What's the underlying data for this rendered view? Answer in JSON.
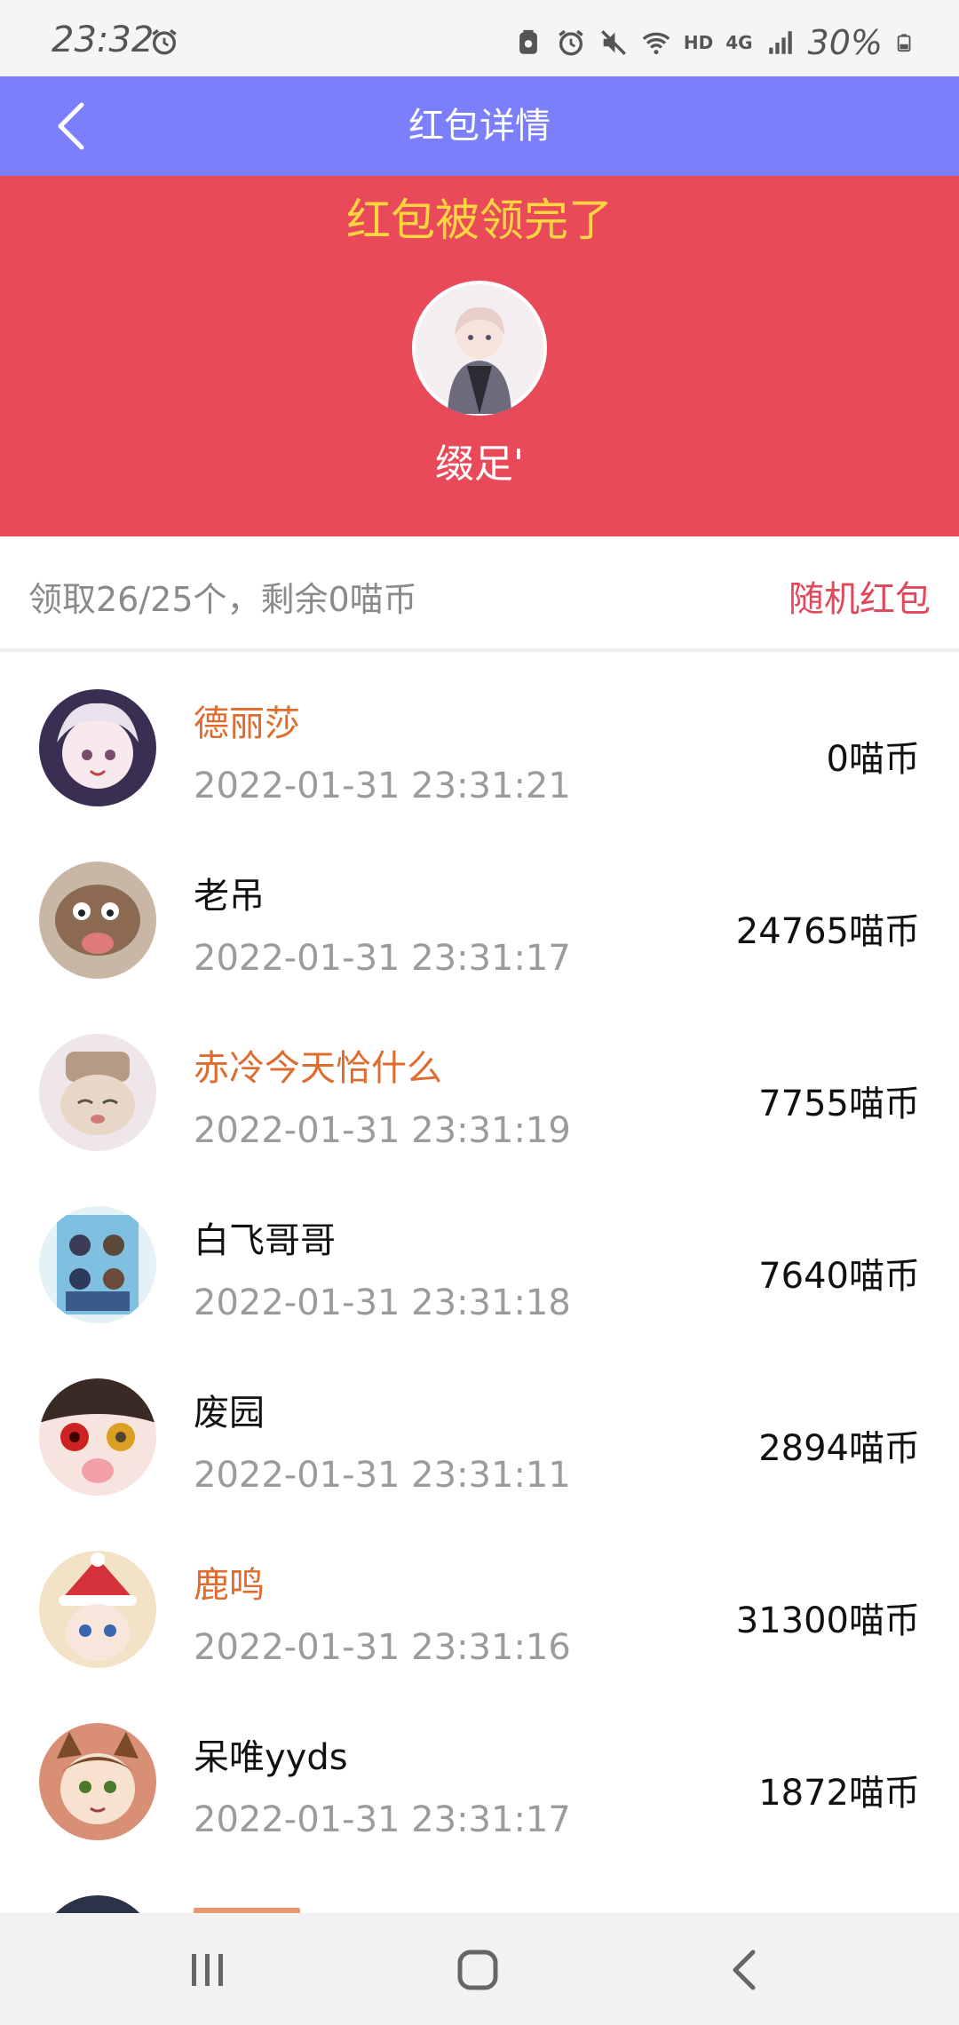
{
  "status_bar": {
    "time": "23:32",
    "hd_label": "HD",
    "network_label": "4G",
    "battery_text": "30%"
  },
  "app_bar": {
    "title": "红包详情"
  },
  "header": {
    "status_text": "红包被领完了",
    "sender_name": "缀足'",
    "background_color": "#e84a5a",
    "status_color": "#ffd540"
  },
  "summary": {
    "claimed_text": "领取26/25个，剩余0喵币",
    "packet_type": "随机红包"
  },
  "claims": [
    {
      "name": "德丽莎",
      "time": "2022-01-31 23:31:21",
      "amount": "0喵币",
      "highlight": true
    },
    {
      "name": "老吊",
      "time": "2022-01-31 23:31:17",
      "amount": "24765喵币",
      "highlight": false
    },
    {
      "name": "赤冷今天恰什么",
      "time": "2022-01-31 23:31:19",
      "amount": "7755喵币",
      "highlight": true
    },
    {
      "name": "白飞哥哥",
      "time": "2022-01-31 23:31:18",
      "amount": "7640喵币",
      "highlight": false
    },
    {
      "name": "废园",
      "time": "2022-01-31 23:31:11",
      "amount": "2894喵币",
      "highlight": false
    },
    {
      "name": "鹿鸣",
      "time": "2022-01-31 23:31:16",
      "amount": "31300喵币",
      "highlight": true
    },
    {
      "name": "呆唯yyds",
      "time": "2022-01-31 23:31:17",
      "amount": "1872喵币",
      "highlight": false
    }
  ],
  "colors": {
    "app_bar": "#7b7ffb",
    "highlight_name": "#e06b2e",
    "packet_type": "#e0485b"
  },
  "icons": {
    "back": "chevron-left-icon",
    "alarm": "alarm-icon",
    "mute": "mute-icon",
    "wifi": "wifi-icon",
    "signal": "signal-icon",
    "battery": "battery-icon",
    "nav_recents": "recents-icon",
    "nav_home": "home-icon",
    "nav_back": "back-icon"
  }
}
